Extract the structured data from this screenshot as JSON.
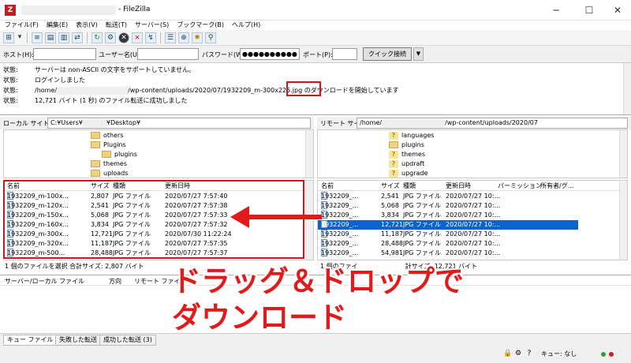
{
  "window": {
    "title": "- FileZilla",
    "controls": [
      "─",
      "☐",
      "✕"
    ]
  },
  "menu": [
    "ファイル(F)",
    "編集(E)",
    "表示(V)",
    "転送(T)",
    "サーバー(S)",
    "ブックマーク(B)",
    "ヘルプ(H)"
  ],
  "quickconnect": {
    "host_label": "ホスト(H):",
    "user_label": "ユーザー名(U):",
    "pass_label": "パスワード(W):",
    "pass_value": "●●●●●●●●●●",
    "port_label": "ポート(P):",
    "connect_label": "クイック接続(Q)",
    "dropdown": "▼"
  },
  "log": [
    {
      "key": "状態:",
      "text": "サーバーは non-ASCII の文字をサポートしていません。"
    },
    {
      "key": "状態:",
      "text": "ログインしました"
    },
    {
      "key": "状態:",
      "text_pre": "/home/",
      "text_mid": "/wp-content/uploads/2020/07/1932209_m-300x225.jpg の",
      "text_hl": "ダウンロード",
      "text_post": "を開始しています"
    },
    {
      "key": "状態:",
      "text": "12,721 バイト (1 秒) のファイル転送に成功しました"
    }
  ],
  "local": {
    "site_label": "ローカル サイト:",
    "path_pre": "C:¥Users¥",
    "path_post": "¥Desktop¥",
    "tree": [
      "others",
      "Plugins",
      "plugins",
      "themes",
      "uploads"
    ],
    "headers": {
      "name": "名前",
      "size": "サイズ",
      "type": "種類",
      "modified": "更新日時"
    },
    "files": [
      {
        "name": "1932209_m-100x...",
        "size": "2,807",
        "type": "JPG ファイル",
        "modified": "2020/07/27 7:57:40"
      },
      {
        "name": "1932209_m-120x...",
        "size": "2,541",
        "type": "JPG ファイル",
        "modified": "2020/07/27 7:57:38"
      },
      {
        "name": "1932209_m-150x...",
        "size": "5,068",
        "type": "JPG ファイル",
        "modified": "2020/07/27 7:57:33"
      },
      {
        "name": "1932209_m-160x...",
        "size": "3,834",
        "type": "JPG ファイル",
        "modified": "2020/07/27 7:57:32"
      },
      {
        "name": "1932209_m-300x...",
        "size": "12,721",
        "type": "JPG ファイル",
        "modified": "2020/07/30 11:22:24"
      },
      {
        "name": "1932209_m-320x...",
        "size": "11,187",
        "type": "JPG ファイル",
        "modified": "2020/07/27 7:57:35"
      },
      {
        "name": "1932209_m-500...",
        "size": "28,488",
        "type": "JPG ファイル",
        "modified": "2020/07/27 7:57:37"
      }
    ],
    "status": "1 個のファイルを選択 合計サイズ: 2,807 バイト"
  },
  "remote": {
    "site_label": "リモート サイト:",
    "path_pre": "/home/",
    "path_post": "/wp-content/uploads/2020/07",
    "tree": [
      "languages",
      "plugins",
      "themes",
      "updraft",
      "upgrade"
    ],
    "headers": {
      "name": "名前",
      "size": "サイズ",
      "type": "種類",
      "modified": "更新日時",
      "perm": "パーミッション",
      "owner": "所有者/グ..."
    },
    "files": [
      {
        "name": "1932209_...",
        "size": "2,541",
        "type": "JPG ファイル",
        "modified": "2020/07/27 10:..."
      },
      {
        "name": "1932209_...",
        "size": "5,068",
        "type": "JPG ファイル",
        "modified": "2020/07/27 10:..."
      },
      {
        "name": "1932209_...",
        "size": "3,834",
        "type": "JPG ファイル",
        "modified": "2020/07/27 10:..."
      },
      {
        "name": "1932209_...",
        "size": "12,721",
        "type": "JPG ファイル",
        "modified": "2020/07/27 10:..."
      },
      {
        "name": "1932209_...",
        "size": "11,187",
        "type": "JPG ファイル",
        "modified": "2020/07/27 10:..."
      },
      {
        "name": "1932209_...",
        "size": "28,488",
        "type": "JPG ファイル",
        "modified": "2020/07/27 10:..."
      },
      {
        "name": "1932209_...",
        "size": "54,981",
        "type": "JPG ファイル",
        "modified": "2020/07/27 10:..."
      }
    ],
    "status_pre": "1 個のファイ",
    "status_post": "計サイズ: 12,721 バイト"
  },
  "queue": {
    "col_server": "サーバー/ローカル ファイル",
    "col_dir": "方向",
    "col_remote": "リモート ファイル",
    "tabs": [
      "キュー ファイル",
      "失敗した転送",
      "成功した転送 (3)"
    ]
  },
  "statusbar": {
    "queue": "キュー: なし"
  },
  "annotation": {
    "line1": "ドラッグ＆ドロップで",
    "line2": "ダウンロード"
  },
  "colors": {
    "highlight_red": "#d0141c",
    "selection_blue": "#0a64d0",
    "annotation_red": "#e11b1b"
  }
}
